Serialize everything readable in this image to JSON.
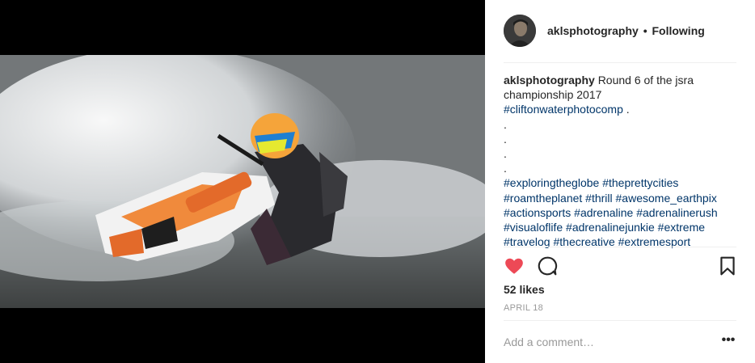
{
  "post": {
    "username": "aklsphotography",
    "separator": "•",
    "follow_status": "Following",
    "caption": {
      "username": "aklsphotography",
      "lines": [
        "Round 6 of the jsra",
        "championship 2017"
      ],
      "tag_line1": "#cliftonwaterphotocomp",
      "tag_line1_suffix": " .",
      "dots": [
        ".",
        ".",
        ".",
        "."
      ],
      "hashtag_lines": [
        "#exploringtheglobe #theprettycities",
        "#roamtheplanet #thrill #awesome_earthpix",
        "#actionsports #adrenaline #adrenalinerush",
        "#visualoflife #adrenalinejunkie #extreme",
        "#travelog #thecreative #extremesport"
      ]
    },
    "likes": "52 likes",
    "date": "APRIL 18",
    "comment_placeholder": "Add a comment…",
    "more_label": "•••",
    "liked": true
  },
  "icons": {
    "heart": "heart-icon",
    "comment": "comment-icon",
    "bookmark": "bookmark-icon"
  },
  "colors": {
    "heart": "#ed4956",
    "hashtag": "#003569",
    "muted": "#999999",
    "text": "#262626"
  }
}
